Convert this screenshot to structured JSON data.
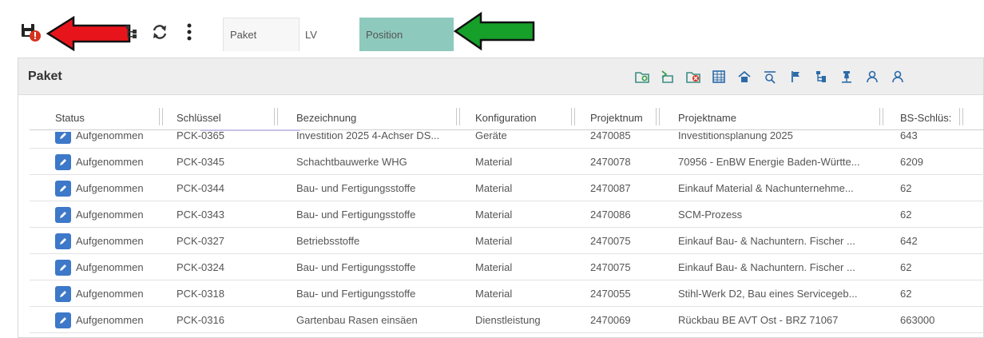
{
  "toolbar": {
    "icons": [
      "save-error-icon",
      "tree-icon",
      "refresh-icon",
      "more-vertical-icon"
    ],
    "tabs": [
      {
        "label": "Paket",
        "active": true
      },
      {
        "label": "LV",
        "active": false
      },
      {
        "label": "Position",
        "active": false,
        "highlight": "#8ec9bd"
      }
    ],
    "tab_menu_glyph": "⋮",
    "annotations": {
      "left_arrow_color": "#e8141b",
      "right_arrow_color": "#16a02a"
    }
  },
  "panel": {
    "title": "Paket",
    "header_icons": [
      "add-folder-icon",
      "import-icon",
      "delete-folder-icon",
      "table-icon",
      "home-edit-icon",
      "search-view-icon",
      "flag-icon",
      "hierarchy-icon",
      "pin-icon",
      "user-search-icon",
      "user-search-icon-2"
    ]
  },
  "table": {
    "columns": [
      "Status",
      "Schlüssel",
      "Bezeichnung",
      "Konfiguration",
      "Projektnum",
      "Projektname",
      "BS-Schlüs:"
    ],
    "rows": [
      {
        "status": "Aufgenommen",
        "key": "PCK-0365",
        "name": "Investition 2025 4-Achser DS...",
        "config": "Geräte",
        "projnum": "2470085",
        "projname": "Investitionsplanung 2025",
        "bs": "643"
      },
      {
        "status": "Aufgenommen",
        "key": "PCK-0345",
        "name": "Schachtbauwerke WHG",
        "config": "Material",
        "projnum": "2470078",
        "projname": "70956 - EnBW Energie Baden-Württe...",
        "bs": "6209"
      },
      {
        "status": "Aufgenommen",
        "key": "PCK-0344",
        "name": "Bau- und Fertigungsstoffe",
        "config": "Material",
        "projnum": "2470087",
        "projname": "Einkauf Material & Nachunternehme...",
        "bs": "62"
      },
      {
        "status": "Aufgenommen",
        "key": "PCK-0343",
        "name": "Bau- und Fertigungsstoffe",
        "config": "Material",
        "projnum": "2470086",
        "projname": "SCM-Prozess",
        "bs": "62"
      },
      {
        "status": "Aufgenommen",
        "key": "PCK-0327",
        "name": "Betriebsstoffe",
        "config": "Material",
        "projnum": "2470075",
        "projname": "Einkauf Bau- & Nachuntern. Fischer ...",
        "bs": "642"
      },
      {
        "status": "Aufgenommen",
        "key": "PCK-0324",
        "name": "Bau- und Fertigungsstoffe",
        "config": "Material",
        "projnum": "2470075",
        "projname": "Einkauf Bau- & Nachuntern. Fischer ...",
        "bs": "62"
      },
      {
        "status": "Aufgenommen",
        "key": "PCK-0318",
        "name": "Bau- und Fertigungsstoffe",
        "config": "Material",
        "projnum": "2470055",
        "projname": "Stihl-Werk D2, Bau eines Servicegeb...",
        "bs": "62"
      },
      {
        "status": "Aufgenommen",
        "key": "PCK-0316",
        "name": "Gartenbau Rasen einsäen",
        "config": "Dienstleistung",
        "projnum": "2470069",
        "projname": "Rückbau BE AVT Ost - BRZ 71067",
        "bs": "663000"
      }
    ]
  },
  "colors": {
    "status_icon": "#3d78c9",
    "panel_header": "#eeeeee",
    "position_tab": "#8ec9bd"
  }
}
